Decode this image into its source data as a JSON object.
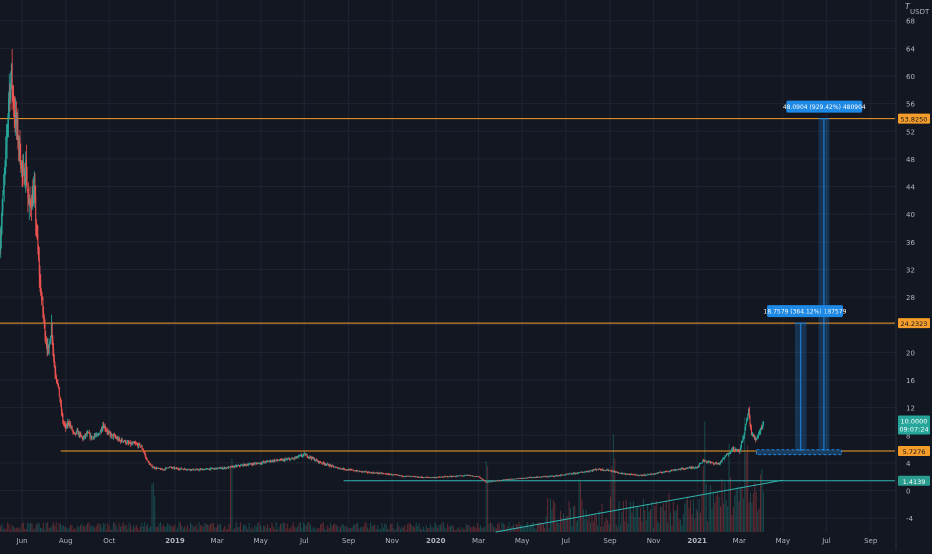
{
  "currency": "USDT",
  "colors": {
    "background": "#131722",
    "grid": "#1f2431",
    "axis_text": "#b2b5be",
    "up": "#26a69a",
    "down": "#ef5350",
    "level_line": "#f59d2a",
    "trend_line": "#2fb6b0",
    "projection": "#1e88e5",
    "projection_fill": "#1c3d5e",
    "current_price_bg": "#26a69a",
    "current_price_low_bg": "#2a9d8f"
  },
  "chart_data": {
    "type": "candlestick",
    "x_axis": {
      "ticks": [
        {
          "label": "Jun",
          "date": "2018-06-01",
          "bold": false
        },
        {
          "label": "Aug",
          "date": "2018-08-01",
          "bold": false
        },
        {
          "label": "Oct",
          "date": "2018-10-01",
          "bold": false
        },
        {
          "label": "2019",
          "date": "2019-01-01",
          "bold": true
        },
        {
          "label": "Mar",
          "date": "2019-03-01",
          "bold": false
        },
        {
          "label": "May",
          "date": "2019-05-01",
          "bold": false
        },
        {
          "label": "Jul",
          "date": "2019-07-01",
          "bold": false
        },
        {
          "label": "Sep",
          "date": "2019-09-01",
          "bold": false
        },
        {
          "label": "Nov",
          "date": "2019-11-01",
          "bold": false
        },
        {
          "label": "2020",
          "date": "2020-01-01",
          "bold": true
        },
        {
          "label": "Mar",
          "date": "2020-03-01",
          "bold": false
        },
        {
          "label": "May",
          "date": "2020-05-01",
          "bold": false
        },
        {
          "label": "Jul",
          "date": "2020-07-01",
          "bold": false
        },
        {
          "label": "Sep",
          "date": "2020-09-01",
          "bold": false
        },
        {
          "label": "Nov",
          "date": "2020-11-01",
          "bold": false
        },
        {
          "label": "2021",
          "date": "2021-01-01",
          "bold": true
        },
        {
          "label": "Mar",
          "date": "2021-03-01",
          "bold": false
        },
        {
          "label": "May",
          "date": "2021-05-01",
          "bold": false
        },
        {
          "label": "Jul",
          "date": "2021-07-01",
          "bold": false
        },
        {
          "label": "Sep",
          "date": "2021-09-01",
          "bold": false
        }
      ],
      "range": [
        "2018-05-01",
        "2021-10-05"
      ]
    },
    "y_axis": {
      "ticks": [
        68,
        64,
        60,
        56,
        52,
        48,
        44,
        40,
        36,
        32,
        28,
        24,
        20,
        16,
        12,
        8,
        4,
        0,
        -4
      ],
      "range": [
        -6,
        71
      ]
    },
    "price_path": [
      [
        "2018-05-01",
        36
      ],
      [
        "2018-05-05",
        42
      ],
      [
        "2018-05-09",
        48
      ],
      [
        "2018-05-13",
        57
      ],
      [
        "2018-05-17",
        60
      ],
      [
        "2018-05-21",
        55
      ],
      [
        "2018-05-25",
        52
      ],
      [
        "2018-05-29",
        49
      ],
      [
        "2018-06-02",
        45
      ],
      [
        "2018-06-06",
        47
      ],
      [
        "2018-06-10",
        41
      ],
      [
        "2018-06-14",
        42
      ],
      [
        "2018-06-18",
        43
      ],
      [
        "2018-06-22",
        36
      ],
      [
        "2018-06-26",
        30
      ],
      [
        "2018-06-30",
        26
      ],
      [
        "2018-07-04",
        22
      ],
      [
        "2018-07-08",
        20
      ],
      [
        "2018-07-12",
        24
      ],
      [
        "2018-07-16",
        18
      ],
      [
        "2018-07-20",
        16
      ],
      [
        "2018-07-24",
        13
      ],
      [
        "2018-07-28",
        10
      ],
      [
        "2018-08-01",
        9
      ],
      [
        "2018-08-05",
        10
      ],
      [
        "2018-08-09",
        9
      ],
      [
        "2018-08-13",
        8
      ],
      [
        "2018-08-17",
        8.5
      ],
      [
        "2018-08-21",
        8
      ],
      [
        "2018-08-25",
        7.5
      ],
      [
        "2018-08-29",
        8
      ],
      [
        "2018-09-02",
        8.2
      ],
      [
        "2018-09-06",
        7.6
      ],
      [
        "2018-09-10",
        8
      ],
      [
        "2018-09-14",
        7.8
      ],
      [
        "2018-09-18",
        8.5
      ],
      [
        "2018-09-22",
        9.5
      ],
      [
        "2018-09-26",
        9
      ],
      [
        "2018-09-30",
        8.2
      ],
      [
        "2018-10-04",
        8
      ],
      [
        "2018-10-08",
        7.8
      ],
      [
        "2018-10-12",
        7.5
      ],
      [
        "2018-10-16",
        7.2
      ],
      [
        "2018-10-20",
        7.3
      ],
      [
        "2018-10-24",
        7
      ],
      [
        "2018-10-28",
        6.8
      ],
      [
        "2018-11-01",
        6.7
      ],
      [
        "2018-11-05",
        6.8
      ],
      [
        "2018-11-09",
        6.6
      ],
      [
        "2018-11-13",
        6.5
      ],
      [
        "2018-11-17",
        6
      ],
      [
        "2018-11-21",
        4.8
      ],
      [
        "2018-11-25",
        4
      ],
      [
        "2018-11-29",
        3.5
      ],
      [
        "2018-12-03",
        3.3
      ],
      [
        "2018-12-07",
        3.2
      ],
      [
        "2018-12-11",
        3.1
      ],
      [
        "2018-12-15",
        3
      ],
      [
        "2018-12-19",
        3.2
      ],
      [
        "2018-12-23",
        3.4
      ],
      [
        "2018-12-27",
        3.3
      ],
      [
        "2019-01-01",
        3.2
      ],
      [
        "2019-01-15",
        3.1
      ],
      [
        "2019-02-01",
        3
      ],
      [
        "2019-02-15",
        3.1
      ],
      [
        "2019-03-01",
        3.2
      ],
      [
        "2019-03-15",
        3.3
      ],
      [
        "2019-04-01",
        3.6
      ],
      [
        "2019-04-15",
        3.8
      ],
      [
        "2019-05-01",
        4
      ],
      [
        "2019-05-15",
        4.3
      ],
      [
        "2019-06-01",
        4.4
      ],
      [
        "2019-06-15",
        4.6
      ],
      [
        "2019-07-01",
        5.2
      ],
      [
        "2019-07-10",
        4.8
      ],
      [
        "2019-07-20",
        4.2
      ],
      [
        "2019-08-01",
        3.8
      ],
      [
        "2019-08-15",
        3.3
      ],
      [
        "2019-09-01",
        3
      ],
      [
        "2019-09-15",
        2.8
      ],
      [
        "2019-10-01",
        2.6
      ],
      [
        "2019-10-15",
        2.5
      ],
      [
        "2019-11-01",
        2.3
      ],
      [
        "2019-11-15",
        2.1
      ],
      [
        "2019-12-01",
        2
      ],
      [
        "2019-12-15",
        1.9
      ],
      [
        "2020-01-01",
        1.9
      ],
      [
        "2020-01-15",
        2
      ],
      [
        "2020-02-01",
        2.1
      ],
      [
        "2020-02-15",
        2.2
      ],
      [
        "2020-03-01",
        2
      ],
      [
        "2020-03-12",
        1.2
      ],
      [
        "2020-03-25",
        1.4
      ],
      [
        "2020-04-10",
        1.6
      ],
      [
        "2020-05-01",
        1.8
      ],
      [
        "2020-05-15",
        1.9
      ],
      [
        "2020-06-01",
        2
      ],
      [
        "2020-06-15",
        2.1
      ],
      [
        "2020-07-01",
        2.3
      ],
      [
        "2020-07-15",
        2.5
      ],
      [
        "2020-08-01",
        2.8
      ],
      [
        "2020-08-15",
        3.1
      ],
      [
        "2020-09-01",
        2.9
      ],
      [
        "2020-09-15",
        2.5
      ],
      [
        "2020-10-01",
        2.3
      ],
      [
        "2020-10-15",
        2.2
      ],
      [
        "2020-11-01",
        2.4
      ],
      [
        "2020-11-15",
        2.7
      ],
      [
        "2020-12-01",
        3
      ],
      [
        "2020-12-15",
        3.2
      ],
      [
        "2021-01-01",
        3.4
      ],
      [
        "2021-01-10",
        4.4
      ],
      [
        "2021-01-20",
        4
      ],
      [
        "2021-02-01",
        3.9
      ],
      [
        "2021-02-10",
        5
      ],
      [
        "2021-02-20",
        6.1
      ],
      [
        "2021-03-01",
        5.6
      ],
      [
        "2021-03-08",
        8.4
      ],
      [
        "2021-03-14",
        11.5
      ],
      [
        "2021-03-18",
        8.2
      ],
      [
        "2021-03-24",
        7.4
      ],
      [
        "2021-03-30",
        8.7
      ],
      [
        "2021-04-04",
        10
      ]
    ],
    "horizontal_levels": [
      {
        "name": "level-top",
        "value": 53.825,
        "label": "53.8250",
        "start": "2018-05-01"
      },
      {
        "name": "level-mid",
        "value": 24.2323,
        "label": "24.2323",
        "start": "2018-05-01"
      },
      {
        "name": "level-low",
        "value": 5.7276,
        "label": "5.7276",
        "start": "2018-07-25"
      }
    ],
    "lines": [
      {
        "name": "support-line",
        "points": [
          [
            "2019-08-25",
            1.4139
          ],
          [
            "2021-10-05",
            1.4139
          ]
        ],
        "label": "1.4139"
      },
      {
        "name": "rising-trend",
        "points": [
          [
            "2020-03-25",
            -6
          ],
          [
            "2021-05-01",
            1.5
          ]
        ]
      }
    ],
    "projection_box": {
      "start": "2021-03-25",
      "end": "2021-07-22",
      "low": 5.2,
      "high": 5.9
    },
    "measurements": [
      {
        "name": "measure-1",
        "x_start": "2021-05-18",
        "x_end": "2021-06-03",
        "from": 5.7276,
        "to": 24.2323,
        "label": "18.7579 (364.12%) 187579",
        "label_x": "2021-06-01"
      },
      {
        "name": "measure-2",
        "x_start": "2021-06-20",
        "x_end": "2021-07-05",
        "from": 5.7276,
        "to": 53.825,
        "label": "48.0904 (929.42%) 480904",
        "label_x": "2021-06-28"
      }
    ],
    "current_price": {
      "value": 10.0,
      "label": "10.0000",
      "countdown": "09:07:24"
    },
    "volume": {
      "start": "2018-05-01",
      "end": "2021-04-04",
      "spike_dates": [
        "2018-12-01",
        "2019-03-20",
        "2020-03-12",
        "2020-07-20",
        "2020-09-05",
        "2021-01-10",
        "2021-02-15",
        "2021-03-10"
      ]
    }
  }
}
